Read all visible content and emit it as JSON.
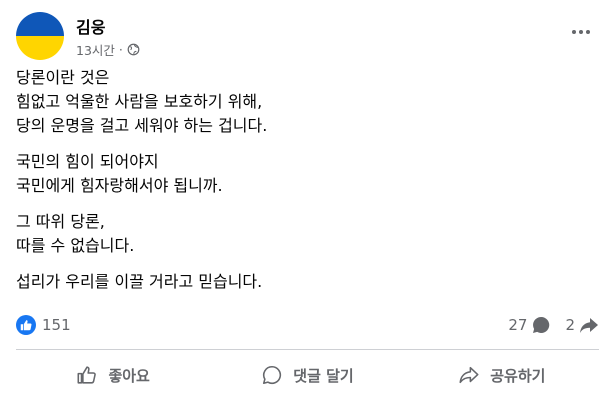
{
  "post": {
    "author": "김웅",
    "time": "13시간",
    "meta_separator": "·",
    "visibility_icon": "globe-icon",
    "more_icon": "more-options-icon",
    "avatar": {
      "flag_top_color": "#0f57b8",
      "flag_bottom_color": "#ffd500"
    },
    "paragraphs": [
      [
        "당론이란 것은",
        "힘없고 억울한 사람을 보호하기 위해,",
        "당의 운명을 걸고 세워야 하는 겁니다."
      ],
      [
        "국민의 힘이 되어야지",
        "국민에게 힘자랑해서야 됩니까."
      ],
      [
        "그 따위 당론,",
        "따를 수 없습니다."
      ],
      [
        "섭리가 우리를 이끌 거라고 믿습니다."
      ]
    ]
  },
  "stats": {
    "likes": "151",
    "comments": "27",
    "shares": "2",
    "like_color": "#1877f2"
  },
  "actions": {
    "like_label": "좋아요",
    "comment_label": "댓글 달기",
    "share_label": "공유하기"
  }
}
